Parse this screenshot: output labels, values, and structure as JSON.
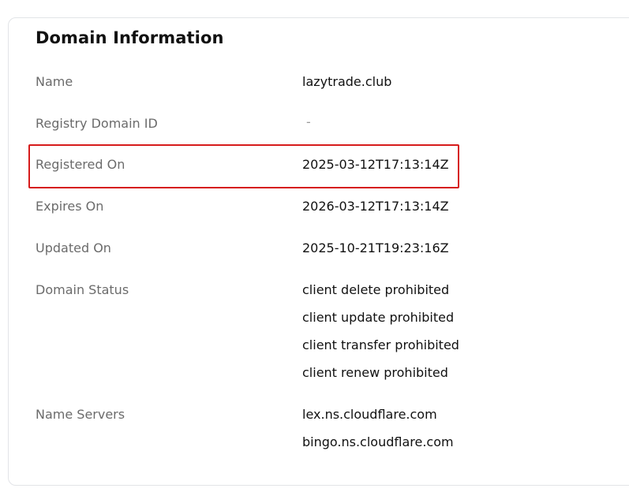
{
  "card": {
    "title": "Domain Information"
  },
  "fields": {
    "name": {
      "label": "Name",
      "value": "lazytrade.club"
    },
    "registry_domain_id": {
      "label": "Registry Domain ID",
      "value": "-"
    },
    "registered_on": {
      "label": "Registered On",
      "value": "2025-03-12T17:13:14Z"
    },
    "expires_on": {
      "label": "Expires On",
      "value": "2026-03-12T17:13:14Z"
    },
    "updated_on": {
      "label": "Updated On",
      "value": "2025-10-21T19:23:16Z"
    },
    "domain_status": {
      "label": "Domain Status",
      "values": [
        "client delete prohibited",
        "client update prohibited",
        "client transfer prohibited",
        "client renew prohibited"
      ]
    },
    "name_servers": {
      "label": "Name Servers",
      "values": [
        "lex.ns.cloudflare.com",
        "bingo.ns.cloudflare.com"
      ]
    }
  },
  "highlight": {
    "color": "#d61b1b"
  }
}
